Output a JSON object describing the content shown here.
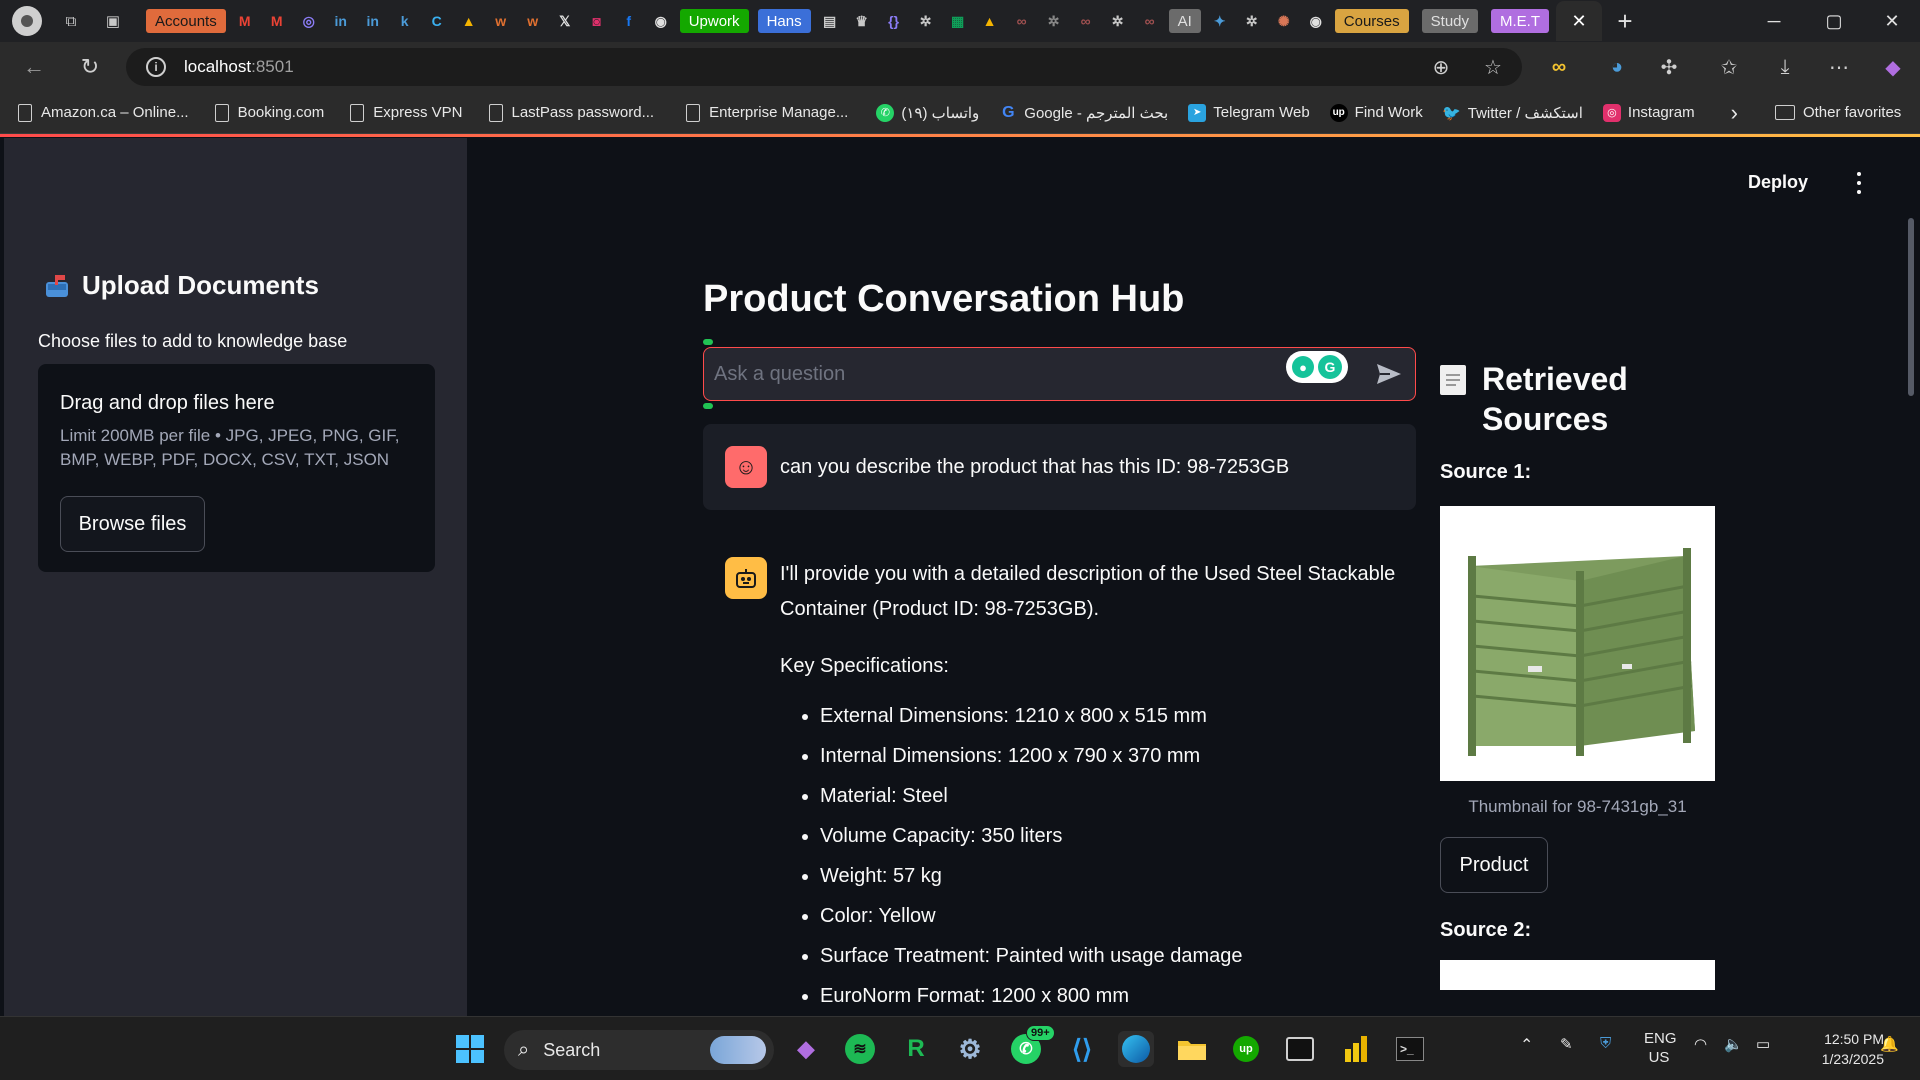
{
  "browser": {
    "pinned_tabs": [
      "Accounts",
      "Upwork",
      "Hans",
      "AI",
      "Courses",
      "Study",
      "M.E.T"
    ],
    "active_tab_close": "✕",
    "new_tab": "+",
    "url_host": "localhost",
    "url_port": ":8501",
    "window_controls": [
      "─",
      "▢",
      "✕"
    ]
  },
  "bookmarks": [
    {
      "label": "Amazon.ca – Online...",
      "icon": "doc-icon"
    },
    {
      "label": "Booking.com",
      "icon": "doc-icon"
    },
    {
      "label": "Express VPN",
      "icon": "doc-icon"
    },
    {
      "label": "LastPass password...",
      "icon": "doc-icon"
    },
    {
      "label": "Enterprise Manage...",
      "icon": "doc-icon"
    },
    {
      "label": "(١٩) واتساب",
      "icon": "whatsapp-icon"
    },
    {
      "label": "Google - بحث المترجم",
      "icon": "google-icon"
    },
    {
      "label": "Telegram Web",
      "icon": "telegram-icon"
    },
    {
      "label": "Find Work",
      "icon": "upwork-icon"
    },
    {
      "label": "Twitter / استكشف",
      "icon": "twitter-icon"
    },
    {
      "label": "Instagram",
      "icon": "instagram-icon"
    }
  ],
  "bookmarks_overflow": "›",
  "other_favorites": "Other favorites",
  "app": {
    "deploy_label": "Deploy",
    "sidebar": {
      "title": "Upload Documents",
      "subtitle": "Choose files to add to knowledge base",
      "dropzone_title": "Drag and drop files here",
      "dropzone_limit": "Limit 200MB per file • JPG, JPEG, PNG, GIF, BMP, WEBP, PDF, DOCX, CSV, TXT, JSON",
      "browse_label": "Browse files"
    },
    "main": {
      "title": "Product Conversation Hub",
      "input_placeholder": "Ask a question",
      "user_message": "can you describe the product that has this ID: 98-7253GB",
      "bot_intro": "I'll provide you with a detailed description of the Used Steel Stackable Container (Product ID: 98-7253GB).",
      "spec_title": "Key Specifications:",
      "specs": [
        "External Dimensions: 1210 x 800 x 515 mm",
        "Internal Dimensions: 1200 x 790 x 370 mm",
        "Material: Steel",
        "Volume Capacity: 350 liters",
        "Weight: 57 kg",
        "Color: Yellow",
        "Surface Treatment: Painted with usage damage",
        "EuroNorm Format: 1200 x 800 mm"
      ]
    },
    "sources": {
      "title": "Retrieved Sources",
      "source1_label": "Source 1:",
      "source1_caption": "Thumbnail for 98-7431gb_31",
      "source1_button": "Product",
      "source2_label": "Source 2:"
    }
  },
  "taskbar": {
    "search_label": "Search",
    "whatsapp_badge": "99+",
    "lang_top": "ENG",
    "lang_bottom": "US",
    "time": "12:50 PM",
    "date": "1/23/2025"
  },
  "colors": {
    "accent": "#ff4b4b",
    "bot_avatar": "#ffbd45",
    "background": "#0e1117",
    "sidebar": "#262730"
  }
}
